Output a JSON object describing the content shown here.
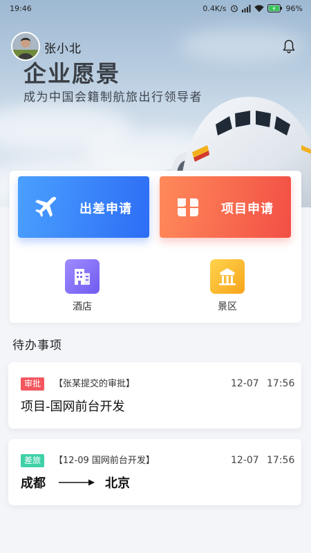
{
  "status_bar": {
    "time": "19:46",
    "network_speed": "0.4K/s",
    "battery": "96%"
  },
  "header": {
    "user_name": "张小北",
    "vision_title": "企业愿景",
    "vision_subtitle": "成为中国会籍制航旅出行领导者"
  },
  "actions": {
    "trip_label": "出差申请",
    "project_label": "项目申请",
    "hotel_label": "酒店",
    "scenic_label": "景区"
  },
  "todo": {
    "section_title": "待办事项",
    "items": [
      {
        "tag": "审批",
        "tag_color": "#f2565e",
        "subtitle": "【张某提交的审批】",
        "date": "12-07",
        "time": "17:56",
        "title": "项目-国网前台开发"
      },
      {
        "tag": "差旅",
        "tag_color": "#3fd0a8",
        "subtitle": "【12-09 国网前台开发】",
        "date": "12-07",
        "time": "17:56",
        "from": "成都",
        "to": "北京"
      }
    ]
  },
  "colors": {
    "trip_gradient": [
      "#4aa0ff",
      "#2d6df5"
    ],
    "project_gradient": [
      "#ff8a5a",
      "#f24f45"
    ],
    "hotel_gradient": [
      "#9f8cff",
      "#6f5bf0"
    ],
    "scenic_gradient": [
      "#ffd34d",
      "#f7a51c"
    ]
  },
  "icons": {
    "trip": "airplane-icon",
    "project": "clover-icon",
    "hotel": "building-icon",
    "scenic": "pavilion-icon",
    "notification": "bell-icon"
  }
}
